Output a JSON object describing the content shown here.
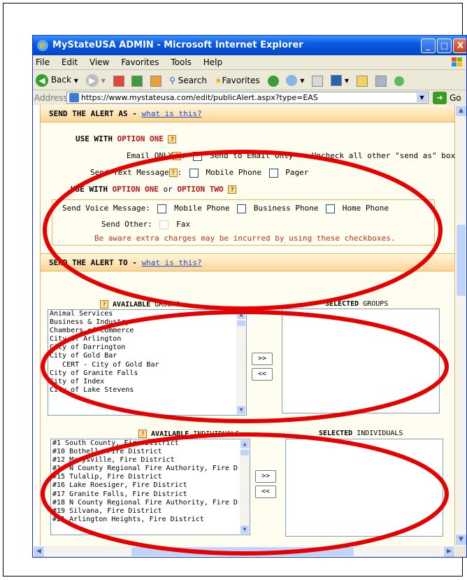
{
  "window": {
    "title": "MyStateUSA ADMIN - Microsoft Internet Explorer",
    "controls": {
      "minimize": "_",
      "maximize": "□",
      "close": "X"
    }
  },
  "menu": [
    {
      "label": "File",
      "icon": ""
    },
    {
      "label": "Edit"
    },
    {
      "label": "View"
    },
    {
      "label": "Favorites"
    },
    {
      "label": "Tools"
    },
    {
      "label": "Help"
    }
  ],
  "toolbar": {
    "back": "Back",
    "search": "Search",
    "favorites": "Favorites"
  },
  "address": {
    "label": "Address",
    "url": "https://www.mystateusa.com/edit/publicAlert.aspx?type=EAS",
    "go": "Go"
  },
  "send_as": {
    "header": "SEND THE ALERT AS",
    "dash": "-",
    "help_link": "what is this?",
    "option_one_prefix": "USE WITH",
    "option_one": "OPTION ONE",
    "email_label": "Email ONLY",
    "email_text": "Send to Email Only -- Uncheck all other \"send as\" boxes.",
    "text_label": "Send Text Message",
    "mobile_phone": "Mobile Phone",
    "pager": "Pager",
    "option_two_prefix": "USE WITH",
    "option_two_one": "OPTION ONE",
    "or": "or",
    "option_two_two": "OPTION TWO",
    "voice_label": "Send Voice Message:",
    "voice_mobile": "Mobile Phone",
    "voice_business": "Business Phone",
    "voice_home": "Home Phone",
    "other_label": "Send Other:",
    "fax": "Fax",
    "warning": "Be aware extra charges may be incurred by using these checkboxes."
  },
  "send_to": {
    "header": "SEND THE ALERT TO",
    "dash": "-",
    "help_link": "what is this?",
    "available_groups_bold": "AVAILABLE",
    "available_groups_rest": "GROUPS",
    "selected_groups_bold": "SELECTED",
    "selected_groups_rest": "GROUPS",
    "groups": [
      "Animal Services",
      "Business & Industry",
      "Chambers of Commerce",
      "City of Arlington",
      "City of Darrington",
      "City of Gold Bar",
      "   CERT - City of Gold Bar",
      "City of Granite Falls",
      "City of Index",
      "City of Lake Stevens"
    ],
    "add": ">>",
    "remove": "<<",
    "available_ind_bold": "AVAILABLE",
    "available_ind_rest": "INDIVIDUALS",
    "selected_ind_bold": "SELECTED",
    "selected_ind_rest": "INDIVIDUALS",
    "individuals": [
      "#1 South County, Fire District",
      "#10 Bothell, Fire District",
      "#12 Marysville, Fire District",
      "#14 N County Regional Fire Authority, Fire D",
      "#15 Tulalip, Fire District",
      "#16 Lake Roesiger, Fire District",
      "#17 Granite Falls, Fire District",
      "#18 N County Regional Fire Authority, Fire D",
      "#19 Silvana, Fire District",
      "#21 Arlington Heights, Fire District"
    ]
  },
  "annotation_color": "#e60000"
}
